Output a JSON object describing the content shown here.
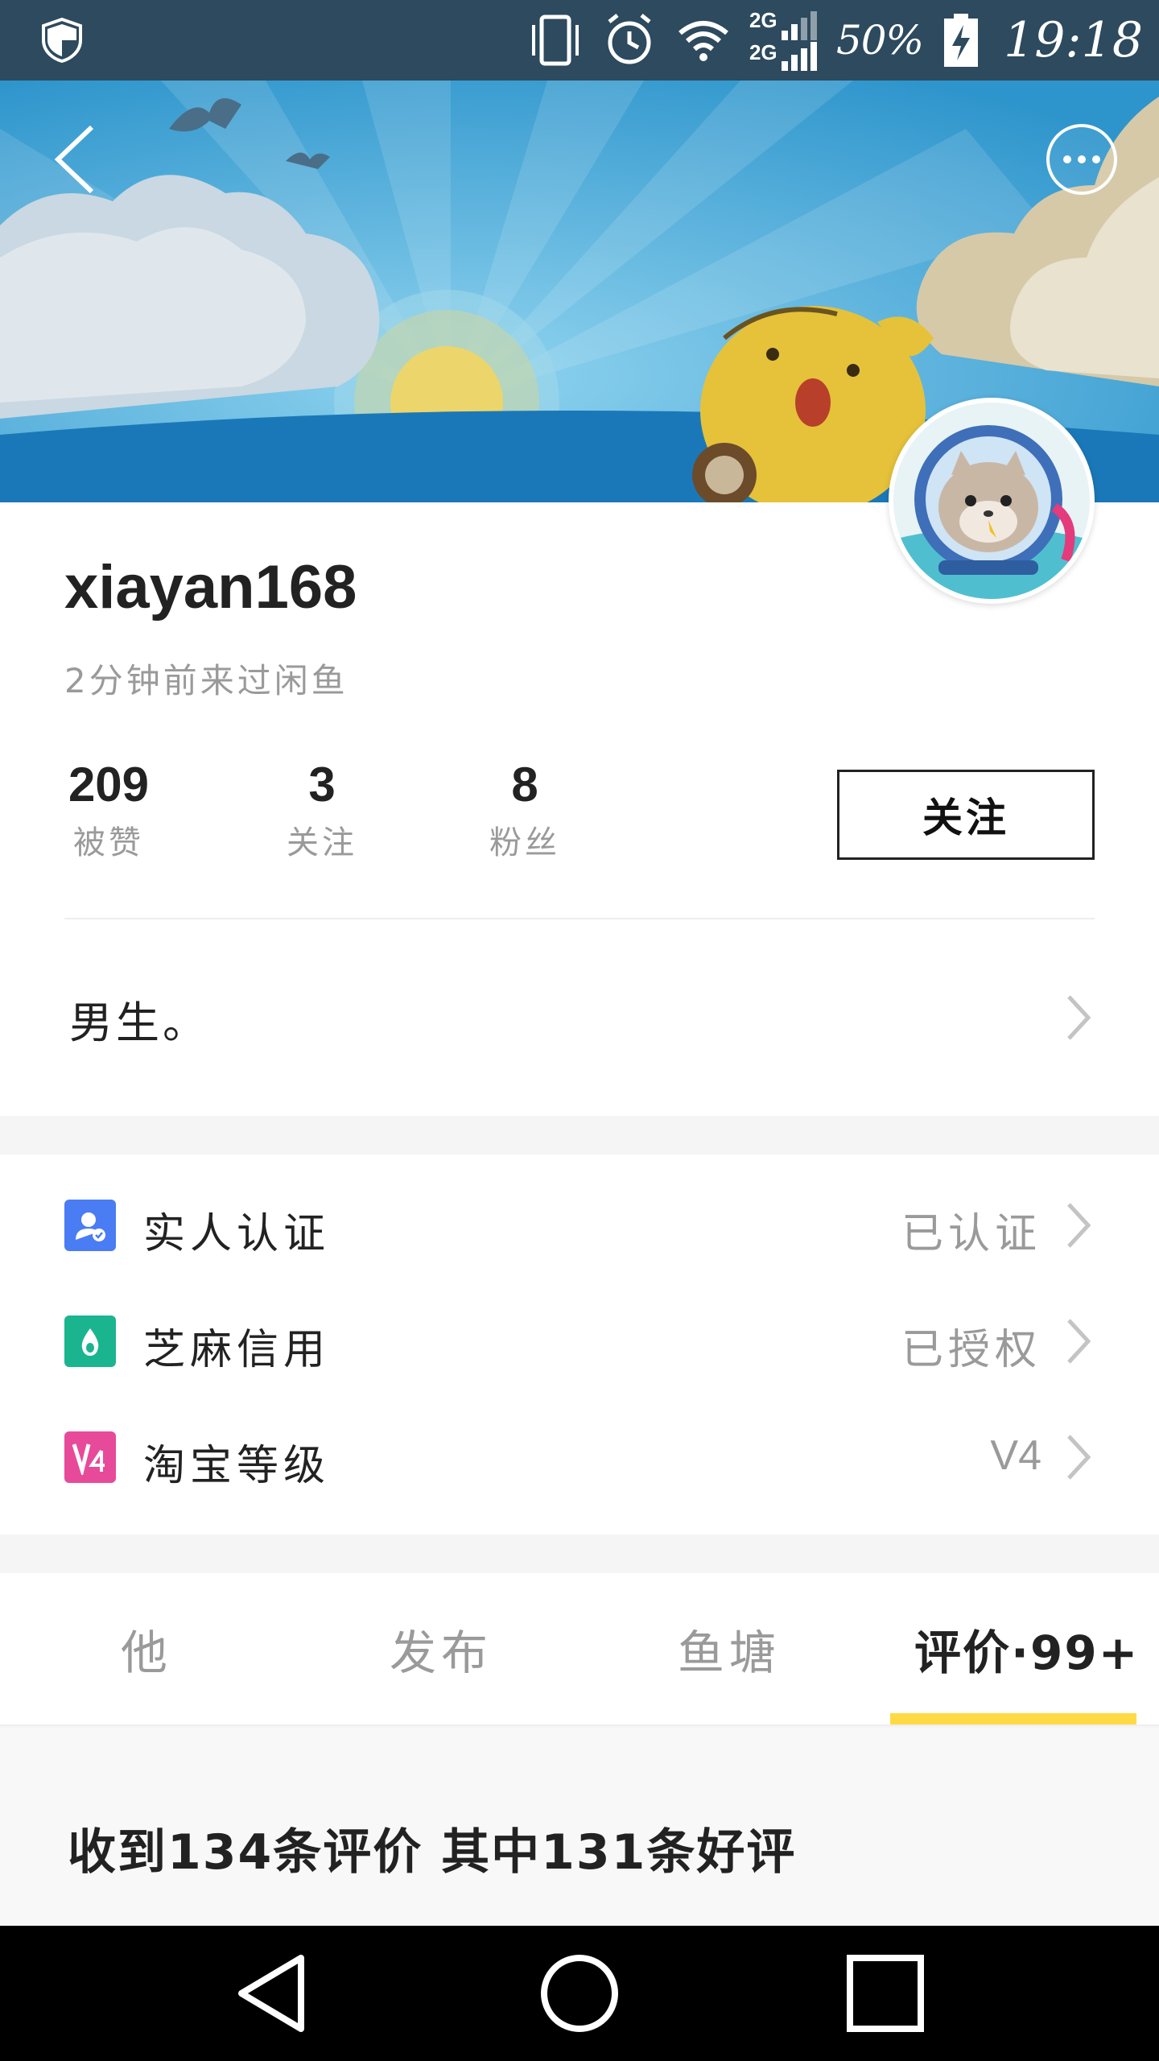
{
  "status_bar": {
    "battery_percent": "50%",
    "time": "19:18",
    "network_1": "2G",
    "network_2": "2G",
    "icons": [
      "shield-icon",
      "vibrate-icon",
      "alarm-icon",
      "wifi-icon",
      "signal-icon",
      "battery-charging-icon"
    ]
  },
  "header": {
    "back_icon": "chevron-left-icon",
    "more_icon": "more-dots-icon"
  },
  "profile": {
    "username": "xiayan168",
    "last_seen": "2分钟前来过闲鱼",
    "stats": [
      {
        "value": "209",
        "label": "被赞"
      },
      {
        "value": "3",
        "label": "关注"
      },
      {
        "value": "8",
        "label": "粉丝"
      }
    ],
    "follow_label": "关注",
    "bio": "男生。"
  },
  "verification": [
    {
      "label": "实人认证",
      "value": "已认证",
      "icon": "person-verified-icon",
      "color": "#4a7cf3"
    },
    {
      "label": "芝麻信用",
      "value": "已授权",
      "icon": "sesame-drop-icon",
      "color": "#1ab58f"
    },
    {
      "label": "淘宝等级",
      "value": "V4",
      "icon": "level-v4-icon",
      "color": "#e84a9a"
    }
  ],
  "tabs": [
    {
      "label": "他"
    },
    {
      "label": "发布"
    },
    {
      "label": "鱼塘"
    },
    {
      "label": "评价·99+"
    }
  ],
  "active_tab_index": 3,
  "reviews": {
    "summary": "收到134条评价 其中131条好评"
  },
  "colors": {
    "accent": "#ffda44",
    "status_bar": "#2d4a5e",
    "sky": "#3fa9d9"
  }
}
